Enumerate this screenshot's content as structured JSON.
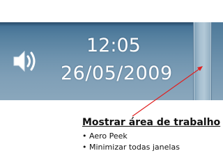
{
  "taskbar": {
    "speaker_icon": "speaker-volume-icon",
    "clock": {
      "time": "12:05",
      "date": "26/05/2009"
    },
    "show_desktop_button": "show-desktop-button"
  },
  "callout": {
    "title": "Mostrar área de trabalho",
    "bullets": [
      "• Aero Peek",
      "• Minimizar todas janelas"
    ],
    "arrow_color": "#e02020"
  },
  "colors": {
    "taskbar": "#6e93ae",
    "clock_text": "#ffffff"
  }
}
